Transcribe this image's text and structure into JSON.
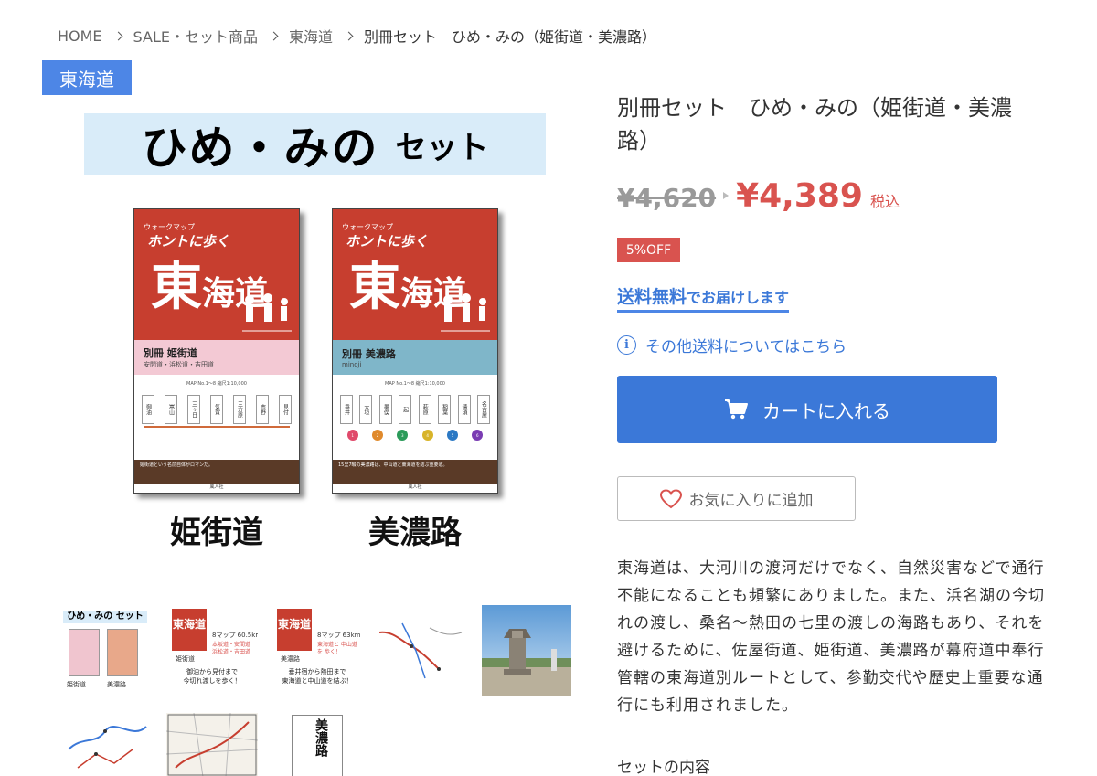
{
  "breadcrumb": {
    "home": "HOME",
    "sale": "SALE・セット商品",
    "tokaido": "東海道",
    "current": "別冊セット　ひめ・みの（姫街道・美濃路）"
  },
  "category_badge": "東海道",
  "main_image": {
    "title_big": "ひめ・みの",
    "title_small": "セット",
    "books": [
      {
        "series": "ウォークマップ",
        "series_name": "ホントに歩く",
        "kanji1": "東",
        "kanji2": "海道",
        "band_line1": "別冊  姫街道",
        "band_line2": "安間道・浜松道・吉田道",
        "map_text": "MAP No.1〜8  縮尺1:10,000",
        "stations": [
          "御油",
          "嵩山",
          "三ヶ日",
          "気賀",
          "三方原",
          "市野",
          "見付"
        ],
        "bottom_text": "姫街道という名前自体がロマンだ。",
        "publisher": "風人社",
        "label": "姫街道"
      },
      {
        "series": "ウォークマップ",
        "series_name": "ホントに歩く",
        "kanji1": "東",
        "kanji2": "海道",
        "band_line1": "別冊  美濃路",
        "band_line2": "minoji",
        "map_text": "MAP No.1〜8  縮尺1:10,000",
        "stations": [
          "垂井",
          "大垣",
          "墨俣",
          "起",
          "萩原",
          "稲葉",
          "清須",
          "名古屋"
        ],
        "bottom_text": "15里7畷の美濃路は、中山道と東海道を結ぶ重要道。",
        "publisher": "風人社",
        "label": "美濃路"
      }
    ]
  },
  "thumbnails": {
    "t1_title": "ひめ・みの セット",
    "t1_labels": [
      "姫街道",
      "美濃路"
    ],
    "t2_title": "東海道",
    "t2_scale": "8マップ 60.5km",
    "t2_sub": "本坂道・安間道 浜松道・吉田道",
    "t2_label": "姫街道",
    "t2_caption1": "御油から見付まで",
    "t2_caption2": "今切れ渡しを歩く！",
    "t3_title": "東海道",
    "t3_scale": "8マップ 63km",
    "t3_sub": "東海道と 中山道を 歩く！",
    "t3_label": "美濃路",
    "t3_caption1": "垂井宿から熱田まで",
    "t3_caption2": "東海道と中山道を結ぶ！",
    "t8_text": "美濃路"
  },
  "product": {
    "title": "別冊セット　ひめ・みの（姫街道・美濃路）",
    "old_price": "¥4,620",
    "new_price": "¥4,389",
    "tax_label": "税込",
    "discount_badge": "5%OFF",
    "shipping_free_main": "送料無料",
    "shipping_free_sub": "でお届けします",
    "shipping_other": "その他送料についてはこちら",
    "cart_button": "カートに入れる",
    "favorite_button": "お気に入りに追加",
    "description": "東海道は、大河川の渡河だけでなく、自然災害などで通行不能になることも頻繁にありました。また、浜名湖の今切れの渡し、桑名〜熱田の七里の渡しの海路もあり、それを避けるために、佐屋街道、姫街道、美濃路が幕府道中奉行管轄の東海道別ルートとして、参勤交代や歴史上重要な通行にも利用されました。",
    "set_heading": "セットの内容"
  },
  "colors": {
    "accent_blue": "#3b78d8",
    "badge_blue": "#4d86e6",
    "price_red": "#d9534f",
    "cover_red": "#c73e2f",
    "title_band": "#d9ecf9"
  }
}
